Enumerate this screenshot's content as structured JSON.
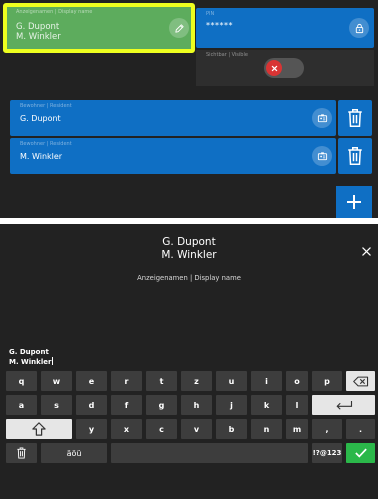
{
  "top_screen": {
    "name_field": {
      "label": "Anzeigenamen | Display name",
      "lines": [
        "G. Dupont",
        "M. Winkler"
      ]
    },
    "pin_field": {
      "label": "PIN",
      "value": "******"
    },
    "toggle_row": {
      "label": "Sichtbar | Visible",
      "state": "off"
    },
    "residents": [
      {
        "label": "Bewohner | Resident",
        "name": "G. Dupont"
      },
      {
        "label": "Bewohner | Resident",
        "name": "M. Winkler"
      }
    ],
    "add_label": "+"
  },
  "keyboard_screen": {
    "title_lines": [
      "G. Dupont",
      "M. Winkler"
    ],
    "subtitle": "Anzeigenamen | Display name",
    "input_lines": [
      "G. Dupont",
      "M. Winkler"
    ],
    "rows": [
      [
        "q",
        "w",
        "e",
        "r",
        "t",
        "z",
        "u",
        "i",
        "o",
        "p"
      ],
      [
        "a",
        "s",
        "d",
        "f",
        "g",
        "h",
        "j",
        "k",
        "l"
      ],
      [
        "y",
        "x",
        "c",
        "v",
        "b",
        "n",
        "m",
        ",",
        "."
      ]
    ],
    "umlaut_key": "äöü",
    "numbers_key": "!?@123"
  },
  "colors": {
    "background": "#222222",
    "field_blue": "#0f6fc4",
    "highlight_yellow": "#eeff1f",
    "selected_green": "#5dac5d",
    "toggle_red": "#d93434",
    "confirm_green": "#2bb84a"
  }
}
